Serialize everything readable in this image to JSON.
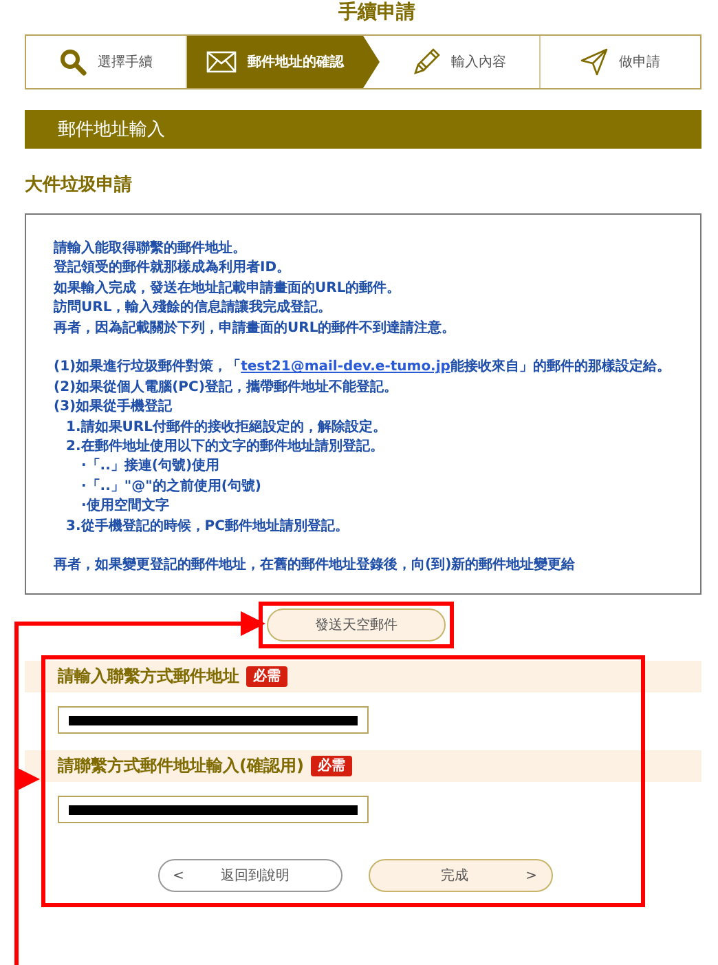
{
  "page_title": "手續申請",
  "steps": [
    {
      "label": "選擇手續",
      "kind": "search",
      "selected": false
    },
    {
      "label": "郵件地址的確認",
      "kind": "mail",
      "selected": true
    },
    {
      "label": "輸入內容",
      "kind": "pencil",
      "selected": false
    },
    {
      "label": "做申請",
      "kind": "send",
      "selected": false
    }
  ],
  "section_header": "郵件地址輸入",
  "subheading": "大件垃圾申請",
  "notice": {
    "paragraphs": [
      [
        {
          "kind": "line",
          "text": "請輸入能取得聯繫的郵件地址。"
        },
        {
          "kind": "line",
          "text": "登記領受的郵件就那樣成為利用者ID。"
        },
        {
          "kind": "line",
          "text": "如果輸入完成，發送在地址記載申請畫面的URL的郵件。"
        },
        {
          "kind": "line",
          "text": "訪問URL，輸入殘餘的信息請讓我完成登記。"
        },
        {
          "kind": "line",
          "text": "再者，因為記載關於下列，申請畫面的URL的郵件不到達請注意。"
        }
      ],
      [
        {
          "kind": "link",
          "before": "(1)如果進行垃圾郵件對策，「",
          "link": "test21@mail-dev.e-tumo.jp",
          "after": "能接收來自」的郵件的那樣設定給。"
        },
        {
          "kind": "line",
          "text": "(2)如果從個人電腦(PC)登記，攜帶郵件地址不能登記。"
        },
        {
          "kind": "line",
          "text": "(3)如果從手機登記"
        },
        {
          "kind": "item",
          "text": "1.請如果URL付郵件的接收拒絕設定的，解除設定。"
        },
        {
          "kind": "item",
          "text": "2.在郵件地址使用以下的文字的郵件地址請別登記。"
        },
        {
          "kind": "subitem",
          "text": "·「..」接連(句號)使用"
        },
        {
          "kind": "subitem",
          "text": "·「..」\"@\"的之前使用(句號)"
        },
        {
          "kind": "subitem",
          "text": "·使用空間文字"
        },
        {
          "kind": "item",
          "text": "3.從手機登記的時候，PC郵件地址請別登記。"
        }
      ],
      [
        {
          "kind": "line",
          "text": "再者，如果變更登記的郵件地址，在舊的郵件地址登錄後，向(到)新的郵件地址變更給"
        }
      ]
    ]
  },
  "send_button": "發送天空郵件",
  "fields": [
    {
      "label": "請輸入聯繫方式郵件地址",
      "badge": "必需"
    },
    {
      "label": "請聯繫方式郵件地址輸入(確認用)",
      "badge": "必需"
    }
  ],
  "back_button": {
    "arrow": "<",
    "label": "返回到說明"
  },
  "submit_button": {
    "label": "完成",
    "arrow": ">"
  }
}
